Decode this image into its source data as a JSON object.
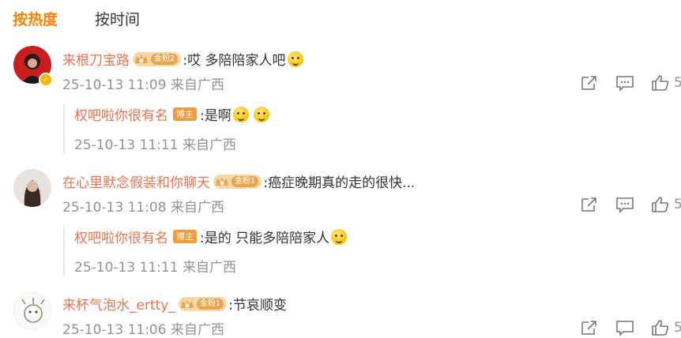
{
  "tabs": {
    "hot": "按热度",
    "time": "按时间"
  },
  "comments": [
    {
      "username": "来根刀宝路",
      "fan_badge": "金粉2",
      "text": ":哎 多陪陪家人吧",
      "meta": "25-10-13 11:09 来自广西",
      "like_count": "5",
      "reply": {
        "username": "权吧啦你很有名",
        "badge": "博主",
        "text": ":是啊",
        "meta": "25-10-13 11:11 来自广西"
      }
    },
    {
      "username": "在心里默念假装和你聊天",
      "fan_badge": "金粉1",
      "text": ":癌症晚期真的走的很快...",
      "meta": "25-10-13 11:08 来自广西",
      "like_count": "5",
      "reply": {
        "username": "权吧啦你很有名",
        "badge": "博主",
        "text": ":是的 只能多陪陪家人",
        "meta": "25-10-13 11:11 来自广西"
      }
    },
    {
      "username": "来杯气泡水_ertty_",
      "fan_badge": "金粉1",
      "text": ":节哀顺变",
      "meta": "25-10-13 11:06 来自广西",
      "like_count": "5"
    }
  ],
  "colors": {
    "accent": "#ff8200",
    "username": "#eb7350",
    "meta": "#939393"
  },
  "icons": [
    "share-icon",
    "comment-icon",
    "like-icon",
    "emoji-icon",
    "verified-icon",
    "fan-crown-icon"
  ]
}
